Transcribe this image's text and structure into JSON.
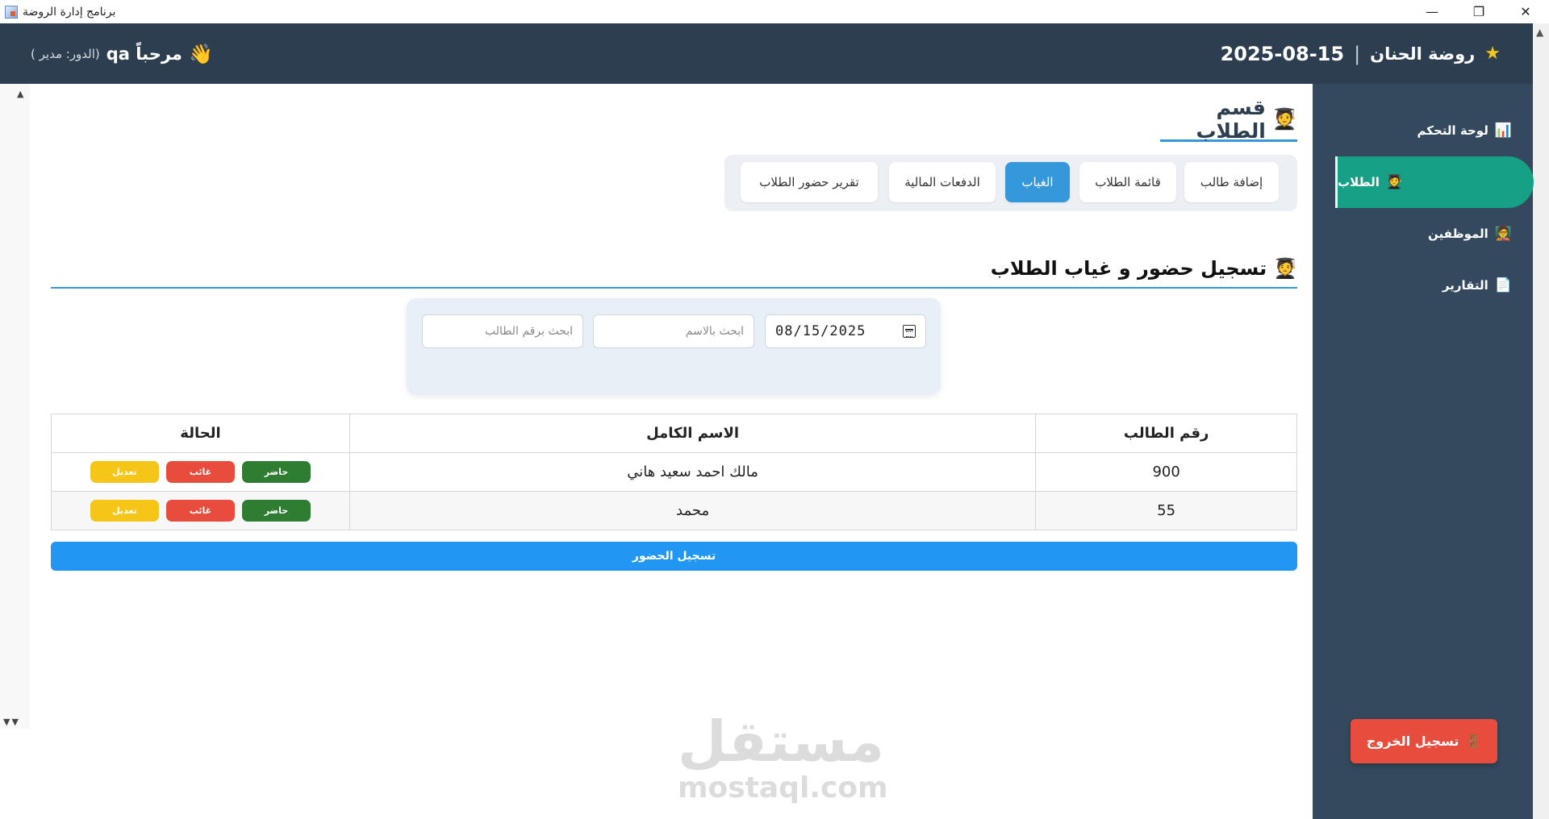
{
  "window": {
    "title": "برنامج إدارة الروضة",
    "controls": {
      "minimize": "—",
      "maximize": "❐",
      "close": "✕"
    }
  },
  "header": {
    "star": "★",
    "school_name": "روضة الحنان",
    "separator": "|",
    "date": "2025-08-15",
    "wave": "👋",
    "greeting": "مرحباً qa",
    "role": "(الدور: مدير )"
  },
  "sidebar": {
    "items": [
      {
        "icon": "📊",
        "label": "لوحة التحكم"
      },
      {
        "icon": "🧑‍🎓",
        "label": "الطلاب"
      },
      {
        "icon": "🧑‍🏫",
        "label": "الموظفين"
      },
      {
        "icon": "📄",
        "label": "التقارير"
      }
    ],
    "active_index": 1,
    "logout": {
      "icon": "🚪",
      "label": "تسجيل الخروج"
    }
  },
  "section": {
    "icon": "🧑‍🎓",
    "title": "قسم الطلاب"
  },
  "tabs": [
    {
      "label": "إضافة طالب"
    },
    {
      "label": "قائمة الطلاب"
    },
    {
      "label": "الغياب"
    },
    {
      "label": "الدفعات المالية"
    },
    {
      "label": "تقرير حضور الطلاب"
    }
  ],
  "active_tab": 2,
  "attendance": {
    "icon": "🧑‍🎓",
    "title": "تسجيل حضور و غياب الطلاب",
    "filters": {
      "date_value": "08/15/2025",
      "name_placeholder": "ابحث بالاسم",
      "id_placeholder": "ابحث برقم الطالب"
    },
    "columns": [
      "رقم الطالب",
      "الاسم الكامل",
      "الحالة"
    ],
    "rows": [
      {
        "id": "900",
        "name": "مالك احمد سعيد هاني"
      },
      {
        "id": "55",
        "name": "محمد"
      }
    ],
    "status_buttons": {
      "present": "حاضر",
      "absent": "غائب",
      "edit": "تعديل"
    },
    "save_label": "تسجيل الحضور"
  },
  "watermark": {
    "ar": "مستقل",
    "en": "mostaql.com"
  },
  "colors": {
    "header": "#2c3e50",
    "sidebar": "#34495e",
    "active_nav": "#16a085",
    "primary": "#3498db",
    "danger": "#e74c3c",
    "success": "#2e7d32",
    "warning": "#f5c518"
  }
}
